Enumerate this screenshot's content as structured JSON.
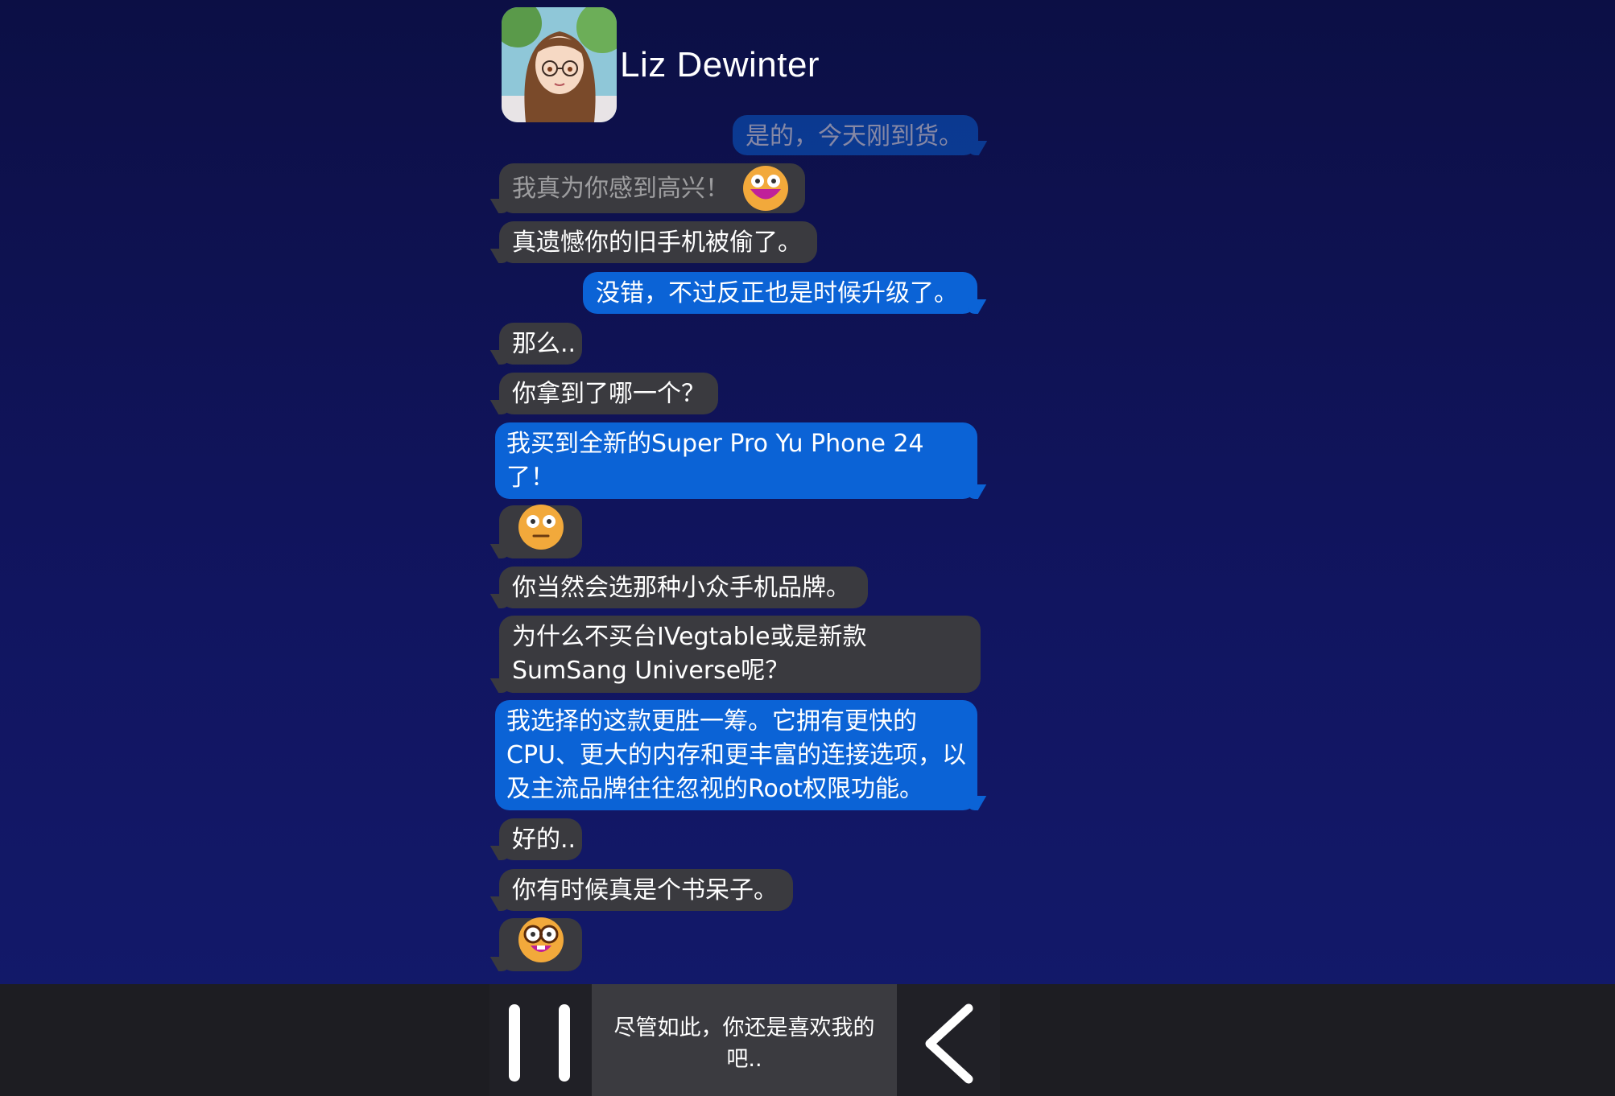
{
  "contact": {
    "name": "Liz Dewinter"
  },
  "messages": [
    {
      "text": "是的，今天刚到货。",
      "side": "out",
      "faded": true
    },
    {
      "text": "我真为你感到高兴！",
      "side": "in",
      "faded": true,
      "emoji": "grinning-face-emoji"
    },
    {
      "text": "真遗憾你的旧手机被偷了。",
      "side": "in"
    },
    {
      "text": "没错，不过反正也是时候升级了。",
      "side": "out"
    },
    {
      "text": "那么..",
      "side": "in"
    },
    {
      "text": "你拿到了哪一个？",
      "side": "in"
    },
    {
      "text": "我买到全新的Super Pro Yu Phone 24了！",
      "side": "out"
    },
    {
      "text": "",
      "side": "in",
      "emoji": "neutral-face-emoji"
    },
    {
      "text": "你当然会选那种小众手机品牌。",
      "side": "in"
    },
    {
      "text": "为什么不买台IVegtable或是新款SumSang Universe呢？",
      "side": "in"
    },
    {
      "text": "我选择的这款更胜一筹。它拥有更快的CPU、更大的内存和更丰富的连接选项，以及主流品牌往往忽视的Root权限功能。",
      "side": "out"
    },
    {
      "text": "好的..",
      "side": "in"
    },
    {
      "text": "你有时候真是个书呆子。",
      "side": "in"
    },
    {
      "text": "",
      "side": "in",
      "emoji": "nerd-face-emoji"
    }
  ],
  "controls": {
    "choice_text": "尽管如此，你还是喜欢我的吧..",
    "pause_icon": "pause-icon",
    "back_icon": "chevron-left-icon"
  },
  "colors": {
    "incoming_bubble": "#3a3a3f",
    "outgoing_bubble": "#0b63d6",
    "background_top": "#0c0f45",
    "background_bottom": "#131a6c",
    "bottom_bar": "#1d1d22"
  }
}
